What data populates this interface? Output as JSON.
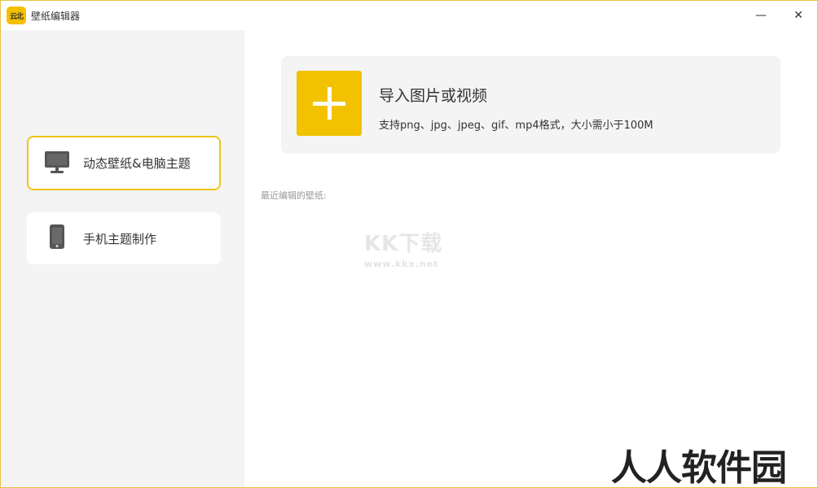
{
  "window": {
    "title": "壁纸编辑器",
    "logo_text": "云北",
    "minimize_glyph": "—",
    "close_glyph": "✕"
  },
  "sidebar": {
    "items": [
      {
        "label": "动态壁纸&电脑主题",
        "icon": "monitor-icon",
        "active": true
      },
      {
        "label": "手机主题制作",
        "icon": "phone-icon",
        "active": false
      }
    ]
  },
  "import": {
    "title": "导入图片或视频",
    "subtitle": "支持png、jpg、jpeg、gif、mp4格式，大小需小于100M",
    "icon": "plus-icon"
  },
  "recent": {
    "label": "最近编辑的壁纸:"
  },
  "watermarks": {
    "kk_text": "KK下载",
    "kk_url": "www.kkx.net",
    "brand": "人人软件园"
  },
  "colors": {
    "accent": "#f2c200",
    "active_border": "#f0c419",
    "sidebar_bg": "#f4f4f4",
    "card_bg": "#f4f4f4"
  }
}
